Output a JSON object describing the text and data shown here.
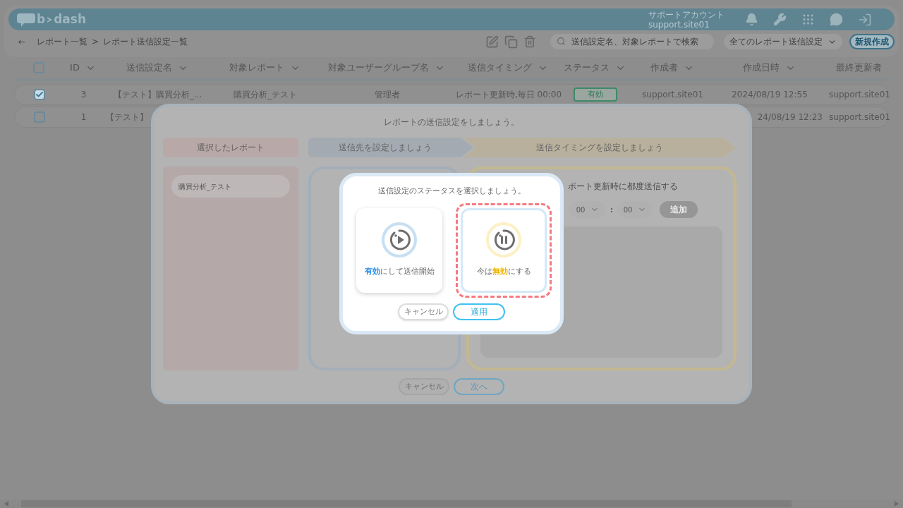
{
  "header": {
    "logo": [
      "b",
      "dash"
    ],
    "account_name": "サポートアカウント",
    "account_id": "support.site01"
  },
  "breadcrumb": {
    "back": "←",
    "items": [
      "レポート一覧",
      "レポート送信設定一覧"
    ],
    "separator": ">"
  },
  "toolbar": {
    "search_placeholder": "送信設定名、対象レポートで検索",
    "filter": "全てのレポート送信設定",
    "new_button": "新規作成"
  },
  "table": {
    "all_checked": false,
    "columns": [
      {
        "label": "ID",
        "sortable": true
      },
      {
        "label": "送信設定名",
        "sortable": true
      },
      {
        "label": "対象レポート",
        "sortable": true
      },
      {
        "label": "対象ユーザーグループ名",
        "sortable": true
      },
      {
        "label": "送信タイミング",
        "sortable": true
      },
      {
        "label": "ステータス",
        "sortable": true
      },
      {
        "label": "作成者",
        "sortable": true
      },
      {
        "label": "作成日時",
        "sortable": true
      },
      {
        "label": "最終更新者",
        "sortable": false
      }
    ],
    "rows": [
      {
        "checked": true,
        "cells": [
          "3",
          "【テスト】購買分析_...",
          "購買分析_テスト",
          "管理者",
          "レポート更新時,毎日 00:00",
          "有効",
          "support.site01",
          "2024/08/19 12:55",
          "support.site01"
        ]
      },
      {
        "checked": false,
        "cells": [
          "1",
          "【テスト】",
          null,
          null,
          null,
          null,
          null,
          "24/08/19 12:23",
          "support.site01"
        ]
      }
    ]
  },
  "wizard": {
    "title": "レポートの送信設定をしましょう。",
    "steps": [
      "選択したレポート",
      "送信先を設定しましょう",
      "送信タイミングを設定しましょう"
    ],
    "selected_report": "購買分析_テスト",
    "timing_option": "ポート更新時に都度送信する",
    "hour": "00",
    "minute": "00",
    "time_separator": ":",
    "add_button": "追加",
    "cancel_button": "キャンセル",
    "next_button": "次へ"
  },
  "status_dialog": {
    "title": "送信設定のステータスを選択しましょう。",
    "options": [
      {
        "kind": "enable",
        "highlight": "有効",
        "rest": "にして送信開始",
        "color": "#2a8ee8",
        "selected": false
      },
      {
        "kind": "disable",
        "prefix": "今は",
        "highlight": "無効",
        "rest": "にする",
        "color": "#f2b400",
        "selected": true
      }
    ],
    "cancel_button": "キャンセル",
    "apply_button": "適用"
  }
}
